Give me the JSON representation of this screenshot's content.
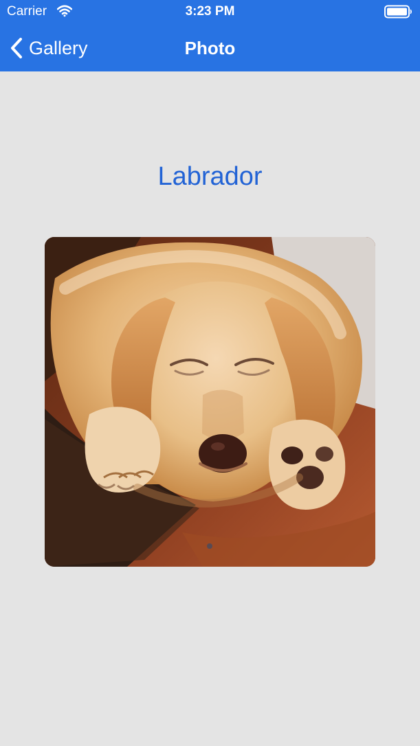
{
  "status_bar": {
    "carrier": "Carrier",
    "time": "3:23 PM",
    "wifi_icon": "wifi-icon",
    "battery_icon": "battery-icon"
  },
  "nav": {
    "back_label": "Gallery",
    "back_icon": "chevron-left-icon",
    "title": "Photo"
  },
  "content": {
    "title": "Labrador",
    "photo_alt": "Labrador"
  },
  "colors": {
    "header": "#2873e3",
    "background": "#e4e4e4",
    "title_text": "#2263d5"
  }
}
